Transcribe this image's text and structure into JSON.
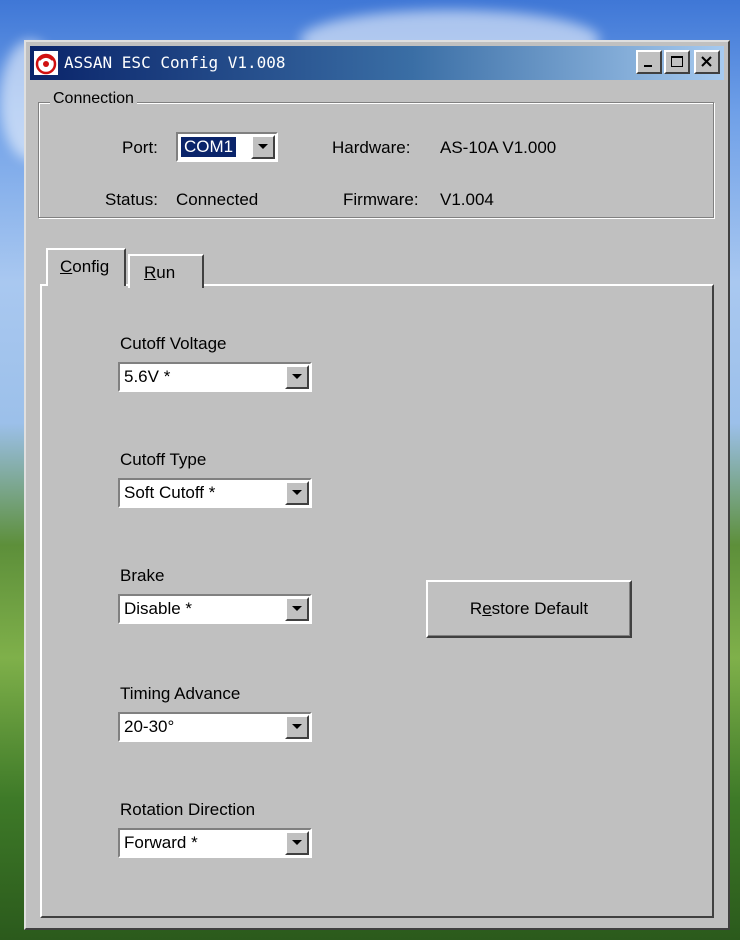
{
  "window": {
    "title": "ASSAN ESC Config V1.008",
    "controls": [
      "minimize-icon",
      "maximize-icon",
      "close-icon"
    ]
  },
  "connection": {
    "group_label": "Connection",
    "port_label": "Port:",
    "port_value": "COM1",
    "status_label": "Status:",
    "status_value": "Connected",
    "hardware_label": "Hardware:",
    "hardware_value": "AS-10A V1.000",
    "firmware_label": "Firmware:",
    "firmware_value": "V1.004"
  },
  "tabs": [
    {
      "label_first": "C",
      "label_rest": "onfig",
      "active": true
    },
    {
      "label_first": "R",
      "label_rest": "un",
      "active": false
    }
  ],
  "config": {
    "fields": [
      {
        "label": "Cutoff Voltage",
        "value": "5.6V *"
      },
      {
        "label": "Cutoff Type",
        "value": "Soft Cutoff *"
      },
      {
        "label": "Brake",
        "value": "Disable *"
      },
      {
        "label": "Timing Advance",
        "value": "20-30°"
      },
      {
        "label": "Rotation Direction",
        "value": "Forward *"
      }
    ],
    "restore_button": {
      "label_pre": "R",
      "label_mnemonic": "e",
      "label_post": "store Default"
    }
  },
  "colors": {
    "title_start": "#0a246a",
    "title_end": "#a6caf0",
    "face": "#c0c0c0",
    "selection": "#0a246a"
  }
}
